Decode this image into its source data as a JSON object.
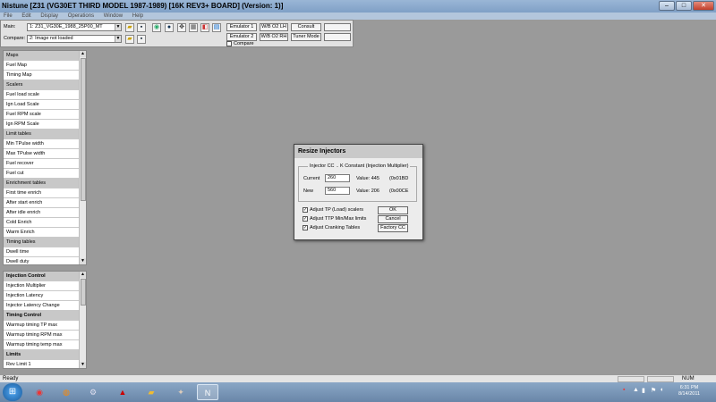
{
  "app": {
    "title": "Nistune [Z31 (VG30ET THIRD MODEL 1987-1989) [16K REV3+ BOARD] (Version: 1)]",
    "window_controls": {
      "minimize": "–",
      "maximize": "□",
      "close": "✕"
    }
  },
  "menu": [
    "File",
    "Edit",
    "Display",
    "Operations",
    "Window",
    "Help"
  ],
  "toolbar": {
    "main_label": "Main:",
    "main_value": "1: Z31_VG30E_1988_25P00_MT",
    "compare_label": "Compare:",
    "compare_value": "2: Image not loaded",
    "buttons": {
      "emulator1": "Emulator 1",
      "emulator2": "Emulator 2",
      "wb_o2_lh": "W/B O2 LH",
      "wb_o2_rh": "W/B O2 RH",
      "consult": "Consult",
      "tuner_mode": "Tuner Mode",
      "compare_check": "Compare"
    },
    "icons": [
      "open-folder-icon",
      "save-icon",
      "open-folder-icon",
      "save-icon",
      "record-icon",
      "target-icon",
      "grid-icon",
      "chip-icon",
      "tag-icon",
      "graph-icon"
    ]
  },
  "sidebar_top": [
    {
      "label": "Maps",
      "kind": "header"
    },
    {
      "label": "Fuel Map",
      "kind": "item"
    },
    {
      "label": "Timing Map",
      "kind": "item"
    },
    {
      "label": "Scalers",
      "kind": "header"
    },
    {
      "label": "Fuel load scale",
      "kind": "item"
    },
    {
      "label": "Ign Load Scale",
      "kind": "item"
    },
    {
      "label": "Fuel RPM scale",
      "kind": "item"
    },
    {
      "label": "Ign RPM Scale",
      "kind": "item"
    },
    {
      "label": "Limit tables",
      "kind": "header"
    },
    {
      "label": "Min TPulse width",
      "kind": "item"
    },
    {
      "label": "Max TPulse width",
      "kind": "item"
    },
    {
      "label": "Fuel recover",
      "kind": "item"
    },
    {
      "label": "Fuel cut",
      "kind": "item"
    },
    {
      "label": "Enrichment tables",
      "kind": "header"
    },
    {
      "label": "First time enrich",
      "kind": "item"
    },
    {
      "label": "After start enrich",
      "kind": "item"
    },
    {
      "label": "After idle enrich",
      "kind": "item"
    },
    {
      "label": "Cold Enrich",
      "kind": "item"
    },
    {
      "label": "Warm Enrich",
      "kind": "item"
    },
    {
      "label": "Timing tables",
      "kind": "header"
    },
    {
      "label": "Dwell time",
      "kind": "item"
    },
    {
      "label": "Dwell duty",
      "kind": "item"
    }
  ],
  "sidebar_bottom": [
    {
      "label": "Injection Control",
      "kind": "header2"
    },
    {
      "label": "Injection Multiplier",
      "kind": "item"
    },
    {
      "label": "Injection Latency",
      "kind": "item"
    },
    {
      "label": "Injector Latency Change",
      "kind": "item"
    },
    {
      "label": "Timing Control",
      "kind": "header2"
    },
    {
      "label": "Warmup timing TP max",
      "kind": "item"
    },
    {
      "label": "Warmup timing RPM max",
      "kind": "item"
    },
    {
      "label": "Warmup timing temp max",
      "kind": "item"
    },
    {
      "label": "Limits",
      "kind": "header2"
    },
    {
      "label": "Rev Limit 1",
      "kind": "item"
    }
  ],
  "dialog": {
    "title": "Resize Injectors",
    "group_injector": "Injector CC",
    "group_kconst": "K Constant (Injection Multiplier)",
    "current_label": "Current",
    "current_value": "260",
    "current_kvalue": "Value: 445",
    "current_hex": "(0x01BD",
    "new_label": "New",
    "new_value": "560",
    "new_kvalue": "Value: 206",
    "new_hex": "(0x00CE",
    "check1": "Adjust TP (Load) scalers",
    "check2": "Adjust TTP Min/Max limits",
    "check3": "Adjust Cranking Tables",
    "ok": "OK",
    "cancel": "Cancel",
    "factory": "Factory CC"
  },
  "status": {
    "left": "Ready",
    "num": "NUM"
  },
  "taskbar": {
    "apps": [
      "chrome-icon",
      "firefox-icon",
      "network-icon",
      "pdf-icon",
      "folder-icon",
      "tools-icon",
      "nistune-icon"
    ],
    "time": "6:31 PM",
    "date": "8/14/2011"
  }
}
